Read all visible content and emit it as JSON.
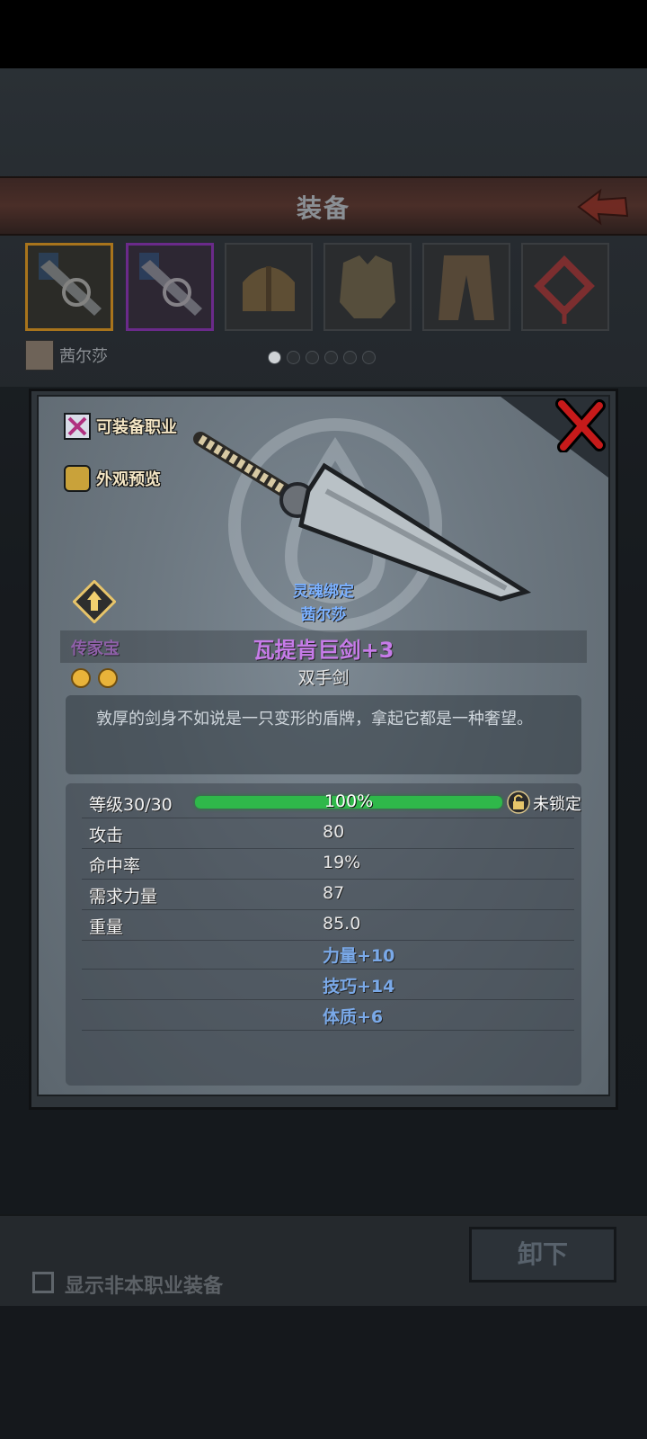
{
  "header": {
    "title": "装备"
  },
  "slots": [
    {
      "name": "weapon-slot-1",
      "state": "selected"
    },
    {
      "name": "weapon-slot-2",
      "state": "purple"
    },
    {
      "name": "helmet-slot",
      "state": "normal"
    },
    {
      "name": "armor-slot",
      "state": "normal"
    },
    {
      "name": "pants-slot",
      "state": "normal"
    },
    {
      "name": "accessory-slot",
      "state": "normal"
    }
  ],
  "character": {
    "name": "茜尔莎"
  },
  "pagination": {
    "count": 6,
    "active": 0
  },
  "modal": {
    "options": {
      "equip_class": "可装备职业",
      "appearance_preview": "外观预览"
    },
    "legacy": {
      "label": "传家宝",
      "gem_count": 2
    },
    "soulbound": {
      "label": "灵魂绑定",
      "owner": "茜尔莎"
    },
    "item": {
      "name": "瓦提肯巨剑+3",
      "type": "双手剑",
      "description": "敦厚的剑身不如说是一只变形的盾牌，拿起它都是一种奢望。"
    },
    "stats": {
      "level_label": "等级",
      "level_value": "30/30",
      "progress_text": "100%",
      "progress": 1.0,
      "lock_label": "未锁定",
      "rows": [
        {
          "key": "攻击",
          "value": "80"
        },
        {
          "key": "命中率",
          "value": "19%"
        },
        {
          "key": "需求力量",
          "value": "87"
        },
        {
          "key": "重量",
          "value": "85.0"
        }
      ],
      "bonuses": [
        "力量+10",
        "技巧+14",
        "体质+6"
      ]
    }
  },
  "footer": {
    "show_other_class_label": "显示非本职业装备",
    "show_other_class_checked": false,
    "unequip_label": "卸下"
  },
  "colors": {
    "legendary": "#c67be8",
    "soulbound": "#7ab0ff",
    "bonus": "#7aa9e8",
    "progress": "#2fb84a"
  }
}
